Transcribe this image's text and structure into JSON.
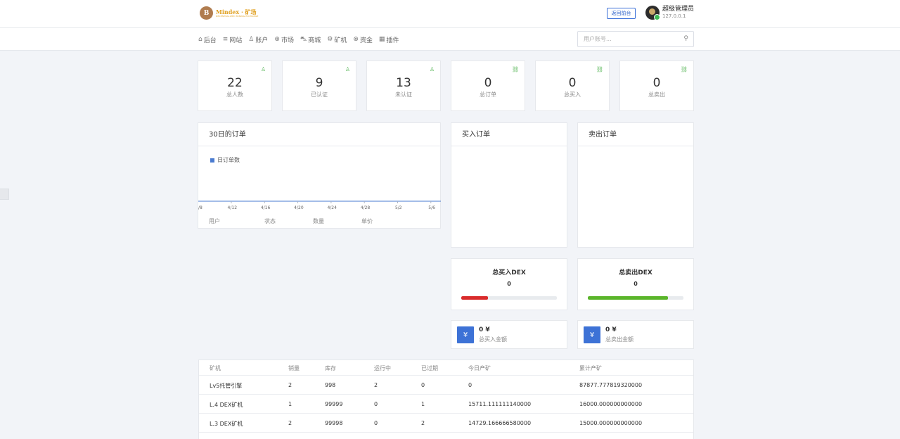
{
  "header": {
    "logo_mark": "B",
    "logo_name": "Mindex · 矿场",
    "logo_sub": "DECENTRALIZED MINING EXCHANGE",
    "back_label": "返回前台",
    "user_name": "超级管理员",
    "user_ip": "127.0.0.1"
  },
  "nav": {
    "items": [
      {
        "label": "后台",
        "icon": "home-icon",
        "glyph": "⌂"
      },
      {
        "label": "网站",
        "icon": "list-icon",
        "glyph": "≡"
      },
      {
        "label": "账户",
        "icon": "users-icon",
        "glyph": "♙"
      },
      {
        "label": "市场",
        "icon": "globe-icon",
        "glyph": "⊕"
      },
      {
        "label": "商城",
        "icon": "cart-icon",
        "glyph": "⛍"
      },
      {
        "label": "矿机",
        "icon": "gear-icon",
        "glyph": "⚙"
      },
      {
        "label": "资金",
        "icon": "coin-icon",
        "glyph": "⊗"
      },
      {
        "label": "插件",
        "icon": "grid-icon",
        "glyph": "▦"
      }
    ],
    "search_placeholder": "用户账号..."
  },
  "stats": [
    {
      "value": "22",
      "label": "总人数",
      "icon": "user-icon"
    },
    {
      "value": "9",
      "label": "已认证",
      "icon": "user-icon"
    },
    {
      "value": "13",
      "label": "未认证",
      "icon": "user-icon"
    },
    {
      "value": "0",
      "label": "总订单",
      "icon": "cart-icon"
    },
    {
      "value": "0",
      "label": "总买入",
      "icon": "cart-icon"
    },
    {
      "value": "0",
      "label": "总卖出",
      "icon": "cart-icon"
    }
  ],
  "orders_panel": {
    "title": "30日的订单",
    "columns": [
      "用户",
      "状态",
      "数量",
      "单价"
    ]
  },
  "chart_data": {
    "type": "line",
    "series": [
      {
        "name": "日订单数",
        "values": []
      }
    ],
    "x_ticks": [
      "/8",
      "4/12",
      "4/16",
      "4/20",
      "4/24",
      "4/28",
      "5/2",
      "5/6"
    ],
    "color": "#4a7bd0"
  },
  "buy_panel": {
    "title": "买入订单"
  },
  "sell_panel": {
    "title": "卖出订单"
  },
  "buy_dex": {
    "title": "总买入DEX",
    "value": "0",
    "fill_fraction": 0.28,
    "color": "#d92b2b"
  },
  "sell_dex": {
    "title": "总卖出DEX",
    "value": "0",
    "fill_fraction": 0.84,
    "color": "#5ab52a"
  },
  "buy_money": {
    "symbol": "¥",
    "value": "0 ¥",
    "label": "总买入金额"
  },
  "sell_money": {
    "symbol": "¥",
    "value": "0 ¥",
    "label": "总卖出金额"
  },
  "miners": {
    "columns": [
      "矿机",
      "销量",
      "库存",
      "运行中",
      "已过期",
      "今日产矿",
      "累计产矿"
    ],
    "rows": [
      [
        "Lv5托管引擎",
        "2",
        "998",
        "2",
        "0",
        "0",
        "87877.777819320000"
      ],
      [
        "L.4 DEX矿机",
        "1",
        "99999",
        "0",
        "1",
        "15711.111111140000",
        "16000.000000000000"
      ],
      [
        "L.3 DEX矿机",
        "2",
        "99998",
        "0",
        "2",
        "14729.166666580000",
        "15000.000000000000"
      ]
    ]
  }
}
